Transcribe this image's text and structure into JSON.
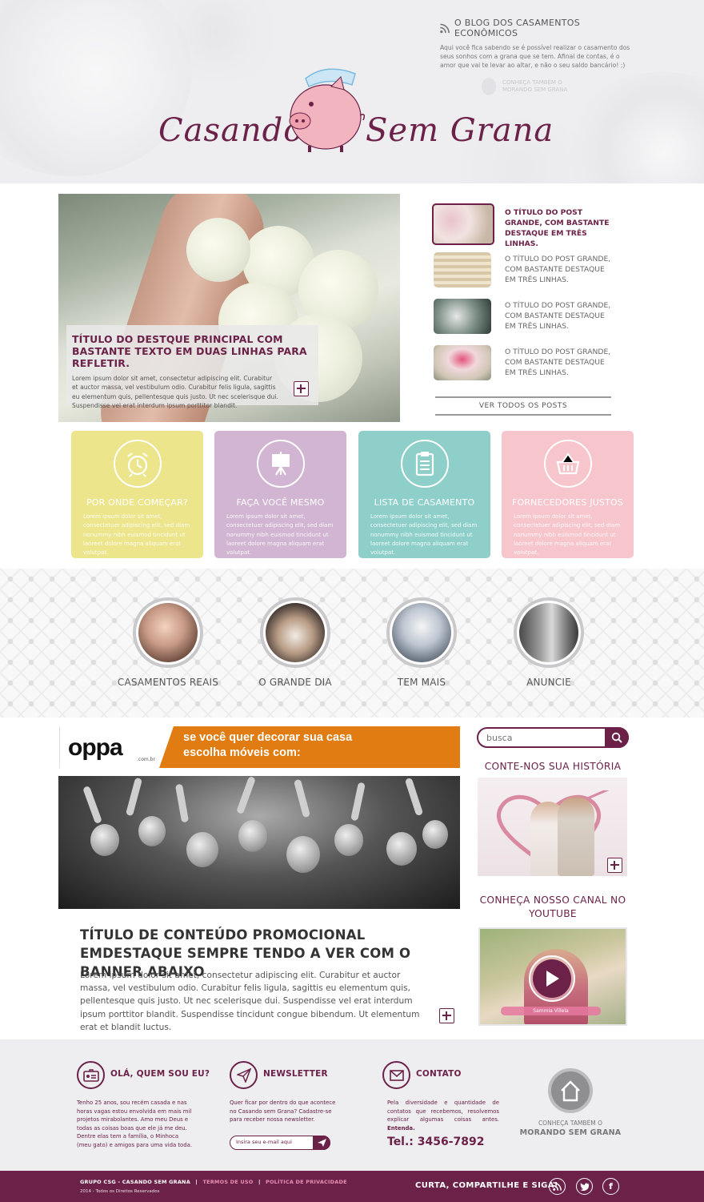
{
  "header": {
    "logo_left": "Casando",
    "logo_right": "Sem Grana",
    "blog_title": "O BLOG DOS CASAMENTOS ECONÔMICOS",
    "blog_desc": "Aqui você fica sabendo se é possível realizar o casamento dos seus sonhos com a grana que se tem. Afinal de contas, é o amor que vai te levar ao altar, e não o seu saldo bancário! ;)",
    "morando_line1": "CONHEÇA TAMBÉM O",
    "morando_line2": "MORANDO SEM GRANA"
  },
  "featured": {
    "title": "TÍTULO DO DESTQUE PRINCIPAL COM BASTANTE TEXTO EM DUAS LINHAS PARA REFLETIR.",
    "text": "Lorem ipsum dolor sit amet, consectetur adipiscing elit. Curabitur et auctor massa, vel vestibulum odio. Curabitur felis ligula, sagittis eu elementum quis, pellentesque quis justo. Ut nec scelerisque dui. Suspendisse vel erat interdum ipsum porttitor blandit."
  },
  "posts": [
    {
      "title": "O TÍTULO DO POST GRANDE, COM BASTANTE DESTAQUE EM TRÊS LINHAS."
    },
    {
      "title": "O TÍTULO DO POST GRANDE, COM BASTANTE DESTAQUE EM TRÊS LINHAS."
    },
    {
      "title": "O TÍTULO DO POST GRANDE, COM BASTANTE DESTAQUE EM TRÊS LINHAS."
    },
    {
      "title": "O TÍTULO DO POST GRANDE, COM BASTANTE DESTAQUE EM TRÊS LINHAS."
    }
  ],
  "ver_todos": "VER TODOS OS POSTS",
  "cards": [
    {
      "title": "POR ONDE COMEÇAR?",
      "icon": "alarm-clock-icon",
      "color": "#ede58b",
      "text": "Lorem ipsum dolor sit amet, consectetuer adipiscing elit, sed diam nonummy nibh euismod tincidunt ut laoreet dolore magna aliquam erat volutpat."
    },
    {
      "title": "FAÇA VOCÊ MESMO",
      "icon": "easel-icon",
      "color": "#d2b5d2",
      "text": "Lorem ipsum dolor sit amet, consectetuer adipiscing elit, sed diam nonummy nibh euismod tincidunt ut laoreet dolore magna aliquam erat volutpat."
    },
    {
      "title": "LISTA DE CASAMENTO",
      "icon": "clipboard-icon",
      "color": "#8ed0c9",
      "text": "Lorem ipsum dolor sit amet, consectetuer adipiscing elit, sed diam nonummy nibh euismod tincidunt ut laoreet dolore magna aliquam erat volutpat."
    },
    {
      "title": "FORNECEDORES JUSTOS",
      "icon": "basket-icon",
      "color": "#f6c6cc",
      "text": "Lorem ipsum dolor sit amet, consectetuer adipiscing elit, sed diam nonummy nibh euismod tincidunt ut laoreet dolore magna aliquam erat volutpat."
    }
  ],
  "categories": [
    "CASAMENTOS REAIS",
    "O GRANDE DIA",
    "TEM MAIS",
    "ANUNCIE"
  ],
  "ad": {
    "brand": "oppa",
    "brand_sub": ".com.br",
    "line1": "se você quer decorar sua casa",
    "line2": "escolha móveis com:"
  },
  "promo": {
    "title": "TÍTULO DE CONTEÚDO PROMOCIONAL EMDESTAQUE SEMPRE TENDO A VER COM O BANNER ABAIXO",
    "text": "Lorem ipsum dolor sit amet, consectetur adipiscing elit. Curabitur et auctor massa, vel vestibulum odio. Curabitur felis ligula, sagittis eu elementum quis, pellentesque quis justo. Ut nec scelerisque dui. Suspendisse vel erat interdum ipsum porttitor blandit. Suspendisse tincidunt congue bibendum. Ut elementum erat et blandit luctus."
  },
  "sidebar": {
    "search_placeholder": "busca",
    "story_title": "CONTE-NOS SUA HISTÓRIA",
    "youtube_title": "CONHEÇA NOSSO CANAL NO YOUTUBE",
    "video_name": "Sammia Villela"
  },
  "footer": {
    "about_title": "OLÁ, QUEM SOU EU?",
    "about_text": "Tenho 25 anos, sou recém casada e nas horas vagas estou envolvida em mais mil projetos mirabolantes. Amo meu Deus e todas as coisas boas que ele já me deu. Dentre elas tem a família, o Minhoca (meu gato) e amigos para uma vida toda.",
    "news_title": "NEWSLETTER",
    "news_text": "Quer ficar por dentro do que acontece no Casando sem Grana? Cadastre-se para receber nossa newsletter.",
    "news_placeholder": "Insira seu e-mail aqui",
    "contact_title": "CONTATO",
    "contact_text": "Pela diversidade e quantidade de contatos que recebemos, resolvemos explicar algumas coisas antes.",
    "contact_link": "Entenda.",
    "tel": "Tel.: 3456-7892",
    "conheca_line1": "CONHEÇA TAMBÉM O",
    "conheca_line2": "MORANDO SEM GRANA"
  },
  "bottom": {
    "group": "GRUPO CSG - CASANDO SEM GRANA",
    "sep": "|",
    "terms": "TERMOS DE USO",
    "privacy": "POLÍTICA DE PRIVACIDADE",
    "copyright": "2014 - Todos os Direitos Reservados",
    "share": "CURTA, COMPARTILHE E SIGA!",
    "facebook_glyph": "f"
  },
  "colors": {
    "brand": "#6b2148",
    "footer_bg": "#eeeef0"
  }
}
